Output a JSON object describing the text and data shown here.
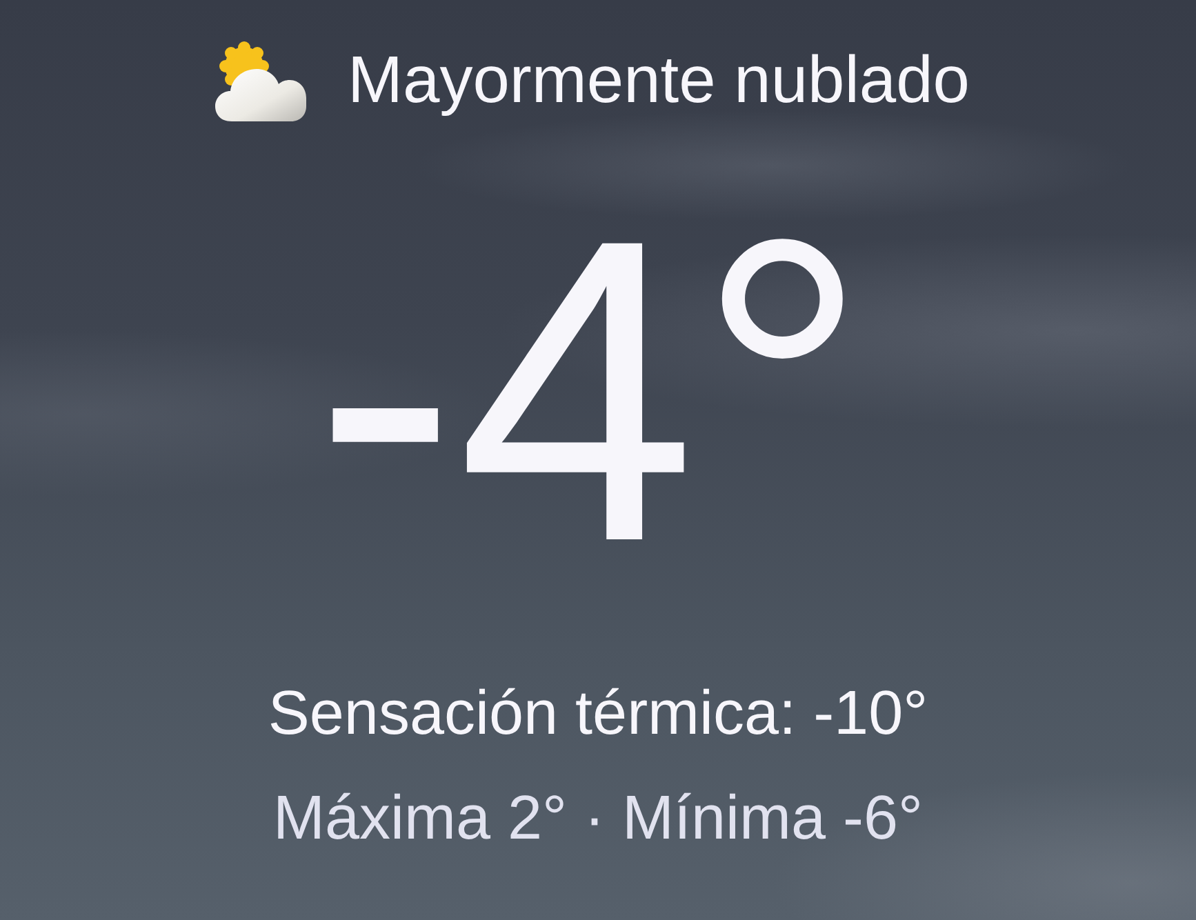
{
  "condition": {
    "text": "Mayormente nublado"
  },
  "temperature": "-4°",
  "feels_like": "Sensación térmica: -10°",
  "high_low": "Máxima 2° · Mínima -6°"
}
